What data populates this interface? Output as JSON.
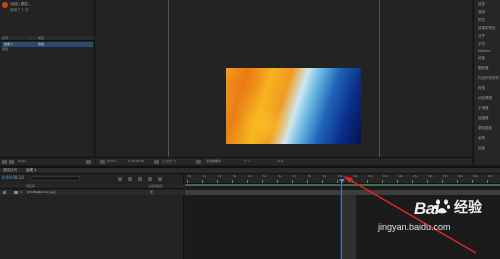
{
  "project_thumb": {
    "name": "(纯色) 图层...",
    "sub": "使用了 1 次"
  },
  "project_panel": {
    "header": {
      "col_name": "名称",
      "col_label": "•",
      "col_type": "类型"
    },
    "selected_item": {
      "name": "合成 1",
      "type": "合成"
    },
    "second_item": "纯色"
  },
  "project_footer": {
    "bpc": "8 bpc"
  },
  "viewer_toolbar": {
    "zoom": "(57%)",
    "timecode": "0:00:08:20",
    "resolution": "(二分之一)",
    "camera": "活动摄像机",
    "views": "1 个...",
    "exposure": "+0.0"
  },
  "right_panel": {
    "items": [
      "信息",
      "音频",
      "预览",
      "效果和预设",
      "对齐",
      "字符",
      "Median",
      "段落",
      "跟踪器",
      "内容识别填充",
      "段落",
      "动态草图",
      "平滑器",
      "摇摆器",
      "蒙版插值",
      "画笔",
      "绘画"
    ]
  },
  "timeline": {
    "tabs": [
      "渲染队列",
      "合成 1"
    ],
    "active_tab": 1,
    "current_time": "0:00:08:20",
    "column_headers": {
      "source": "源名称",
      "parent": "父级和链接"
    },
    "layer": {
      "index": "1",
      "name": "[23d8e6bb7ac.jpg]",
      "parent": "无"
    },
    "ruler_labels": [
      "0s",
      "1s",
      "2s",
      "3s",
      "4s",
      "5s",
      "6s",
      "7s",
      "8s",
      "9s",
      "10s",
      "11s",
      "12s",
      "13s",
      "14s",
      "15s",
      "16s",
      "17s",
      "18s",
      "19s",
      "20s"
    ],
    "playhead_seconds": 8.7
  },
  "watermark": {
    "brand": "Bai",
    "brand_cn": "经验",
    "url": "jingyan.baidu.com"
  },
  "colors": {
    "playhead": "#4a78c9",
    "work_area": "#3c6e4a",
    "annotation": "#e0252b",
    "selection": "#2f4a6e"
  }
}
